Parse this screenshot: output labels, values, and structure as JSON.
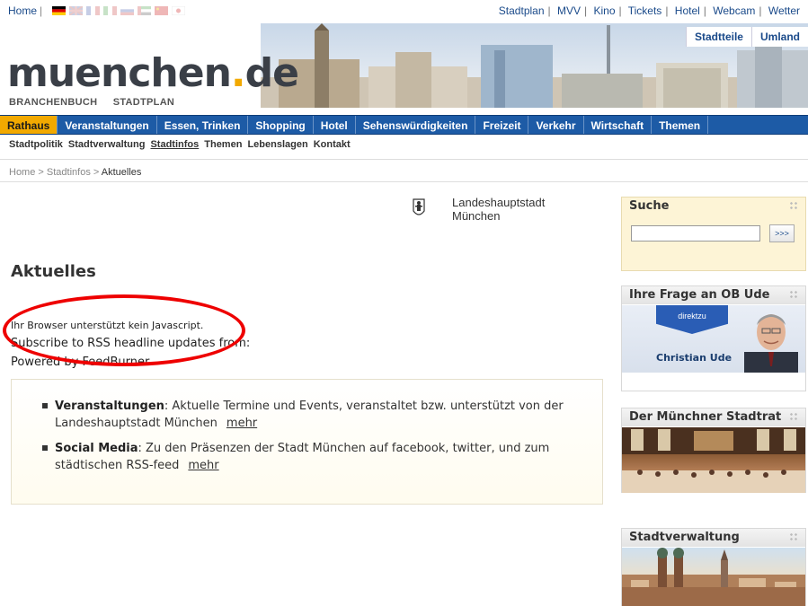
{
  "topbar": {
    "home": "Home",
    "sep": "|",
    "links": [
      "Stadtplan",
      "MVV",
      "Kino",
      "Tickets",
      "Hotel",
      "Webcam",
      "Wetter"
    ]
  },
  "header": {
    "logo_main": "muenchen",
    "logo_dot": ".",
    "logo_tld": "de",
    "subnav": [
      "BRANCHENBUCH",
      "STADTPLAN"
    ],
    "tabs": [
      "Stadtteile",
      "Umland"
    ]
  },
  "mainnav": [
    "Rathaus",
    "Veranstaltungen",
    "Essen, Trinken",
    "Shopping",
    "Hotel",
    "Sehenswürdigkeiten",
    "Freizeit",
    "Verkehr",
    "Wirtschaft",
    "Themen"
  ],
  "subnav": [
    "Stadtpolitik",
    "Stadtverwaltung",
    "Stadtinfos",
    "Themen",
    "Lebenslagen",
    "Kontakt"
  ],
  "breadcrumb": {
    "home": "Home",
    "sep1": ">",
    "section": "Stadtinfos",
    "sep2": ">",
    "current": "Aktuelles"
  },
  "emblem": {
    "line1": "Landeshauptstadt",
    "line2": "München"
  },
  "content": {
    "title": "Aktuelles",
    "nojs": "Ihr Browser unterstützt kein Javascript.",
    "rss": "Subscribe to RSS headline updates from:",
    "feedburner": "Powered by FeedBurner",
    "items": [
      {
        "title": "Veranstaltungen",
        "text": ": Aktuelle Termine und Events, veranstaltet bzw. unterstützt von der Landeshauptstadt München",
        "link": "mehr"
      },
      {
        "title": "Social Media",
        "text": ": Zu den Präsenzen der Stadt München auf facebook, twitter, und zum städtischen RSS-feed",
        "link": "mehr"
      }
    ]
  },
  "sidebar": {
    "search": {
      "title": "Suche",
      "button": ">>>"
    },
    "ob": {
      "title": "Ihre Frage an OB Ude",
      "badge": "direktzu",
      "name": "Christian Ude"
    },
    "stadtrat": {
      "title": "Der Münchner Stadtrat"
    },
    "verwaltung": {
      "title": "Stadtverwaltung"
    }
  },
  "colors": {
    "nav_blue": "#1d5ba6",
    "nav_active": "#f2a900",
    "link": "#1a4a8a",
    "highlight_circle": "#ee0000"
  }
}
